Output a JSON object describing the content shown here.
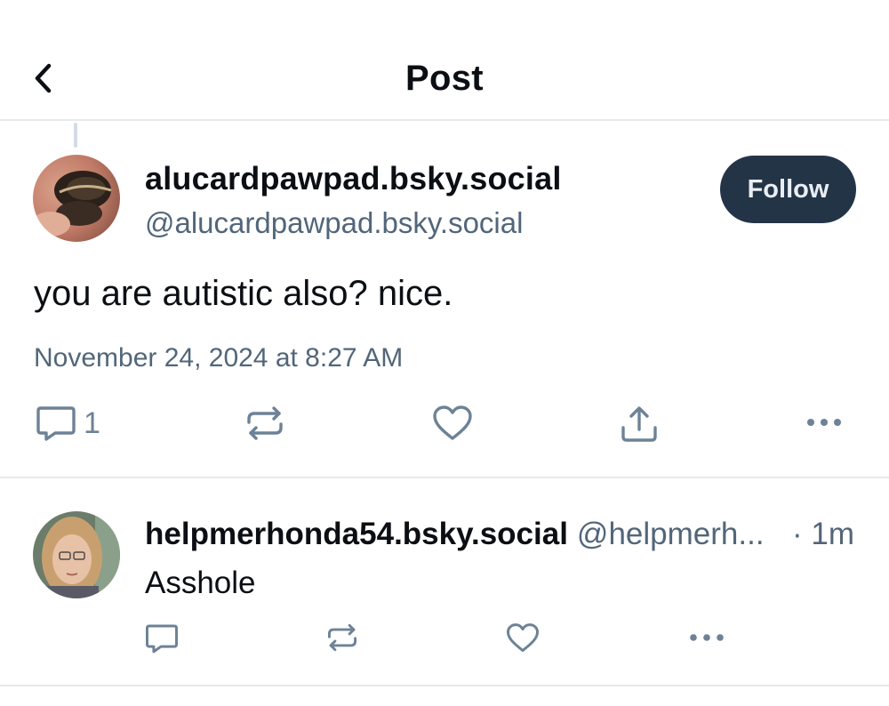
{
  "header": {
    "title": "Post",
    "back_icon": "chevron-left-icon"
  },
  "post": {
    "display_name": "alucardpawpad.bsky.social",
    "handle": "@alucardpawpad.bsky.social",
    "follow_label": "Follow",
    "text": "you are autistic also? nice.",
    "timestamp": "November 24, 2024 at 8:27 AM",
    "reply_count": "1",
    "icons": [
      "reply-icon",
      "repost-icon",
      "like-icon",
      "share-icon",
      "more-icon"
    ]
  },
  "reply": {
    "display_name": "helpmerhonda54.bsky.social",
    "handle": "@helpmerh...",
    "time": "· 1m",
    "text": "Asshole",
    "icons": [
      "reply-icon",
      "repost-icon",
      "like-icon",
      "more-icon"
    ]
  },
  "colors": {
    "text": "#0b0f14",
    "muted": "#52667a",
    "icon": "#6d8296",
    "follow_bg": "#243447",
    "divider": "#e6e9ed"
  }
}
